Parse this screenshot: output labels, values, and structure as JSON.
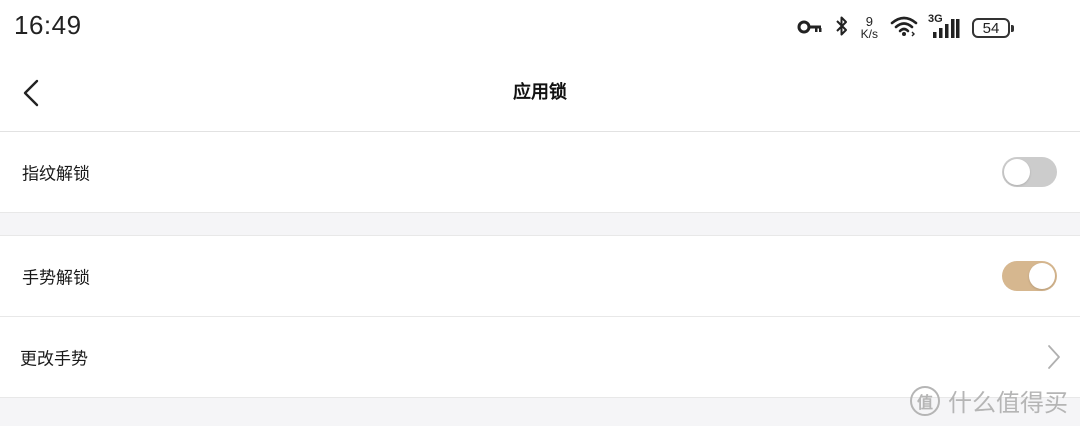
{
  "status_bar": {
    "time": "16:49",
    "net_speed_value": "9",
    "net_speed_unit": "K/s",
    "network_type": "3G",
    "battery": "54",
    "icons": [
      "key-icon",
      "bluetooth-icon",
      "wifi-icon",
      "signal-icon",
      "battery-icon"
    ]
  },
  "nav": {
    "title": "应用锁",
    "back_icon": "chevron-left-icon"
  },
  "settings": {
    "fingerprint_label": "指纹解锁",
    "fingerprint_enabled": false,
    "gesture_label": "手势解锁",
    "gesture_enabled": true,
    "change_gesture_label": "更改手势"
  },
  "watermark": {
    "logo_char": "值",
    "text": "什么值得买"
  },
  "colors": {
    "toggle_on": "#d6b78f",
    "toggle_off": "#cccccc",
    "background": "#f5f5f7"
  }
}
